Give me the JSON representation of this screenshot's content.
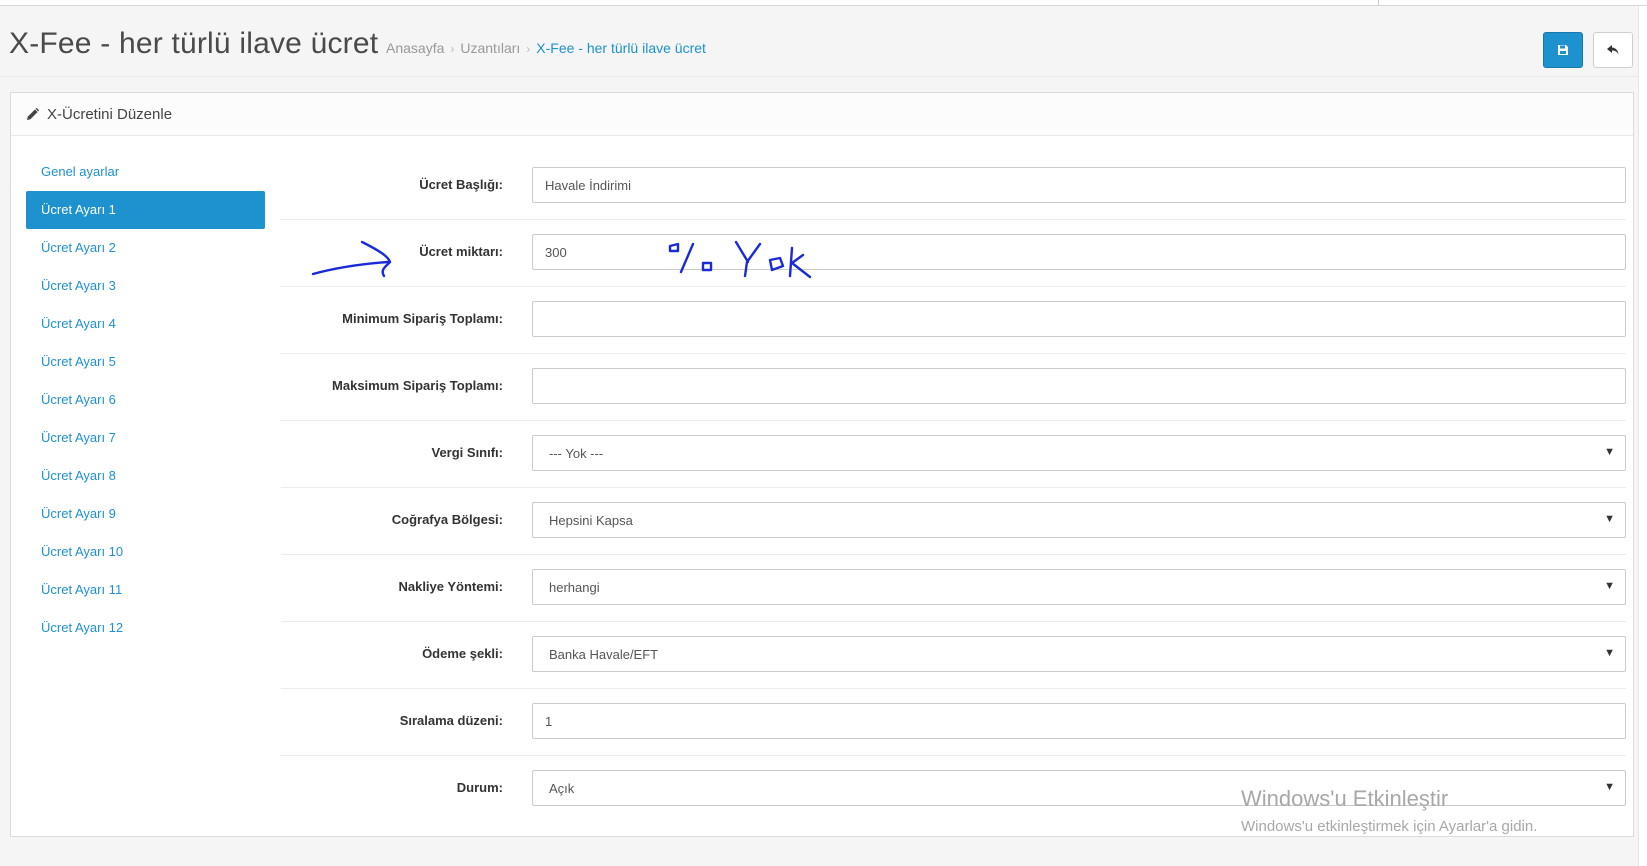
{
  "header": {
    "title": "X-Fee - her türlü ilave ücret",
    "breadcrumb": [
      "Anasayfa",
      "Uzantıları",
      "X-Fee - her türlü ilave ücret"
    ],
    "save_icon": "save-icon",
    "back_icon": "reply-icon"
  },
  "panel": {
    "title": "X-Ücretini Düzenle",
    "icon": "pencil-icon"
  },
  "sidebar": {
    "items": [
      {
        "label": "Genel ayarlar"
      },
      {
        "label": "Ücret Ayarı 1"
      },
      {
        "label": "Ücret Ayarı 2"
      },
      {
        "label": "Ücret Ayarı 3"
      },
      {
        "label": "Ücret Ayarı 4"
      },
      {
        "label": "Ücret Ayarı 5"
      },
      {
        "label": "Ücret Ayarı 6"
      },
      {
        "label": "Ücret Ayarı 7"
      },
      {
        "label": "Ücret Ayarı 8"
      },
      {
        "label": "Ücret Ayarı 9"
      },
      {
        "label": "Ücret Ayarı 10"
      },
      {
        "label": "Ücret Ayarı 11"
      },
      {
        "label": "Ücret Ayarı 12"
      }
    ]
  },
  "form": {
    "title_label": "Ücret Başlığı:",
    "title_value": "Havale İndirimi",
    "amount_label": "Ücret miktarı:",
    "amount_value": "300",
    "min_label": "Minimum Sipariş Toplamı:",
    "min_value": "",
    "max_label": "Maksimum Sipariş Toplamı:",
    "max_value": "",
    "tax_label": "Vergi Sınıfı:",
    "tax_value": "--- Yok ---",
    "geo_label": "Coğrafya Bölgesi:",
    "geo_value": "Hepsini Kapsa",
    "shipping_label": "Nakliye Yöntemi:",
    "shipping_value": "herhangi",
    "payment_label": "Ödeme şekli:",
    "payment_value": "Banka Havale/EFT",
    "sort_label": "Sıralama düzeni:",
    "sort_value": "1",
    "status_label": "Durum:",
    "status_value": "Açık"
  },
  "annotation": {
    "handwritten_text": "% Yok",
    "color": "#1a2ad8"
  },
  "watermark": {
    "line1": "Windows'u Etkinleştir",
    "line2": "Windows'u etkinleştirmek için Ayarlar'a gidin."
  },
  "colors": {
    "accent": "#1e91cf",
    "background": "#f5f5f5"
  }
}
